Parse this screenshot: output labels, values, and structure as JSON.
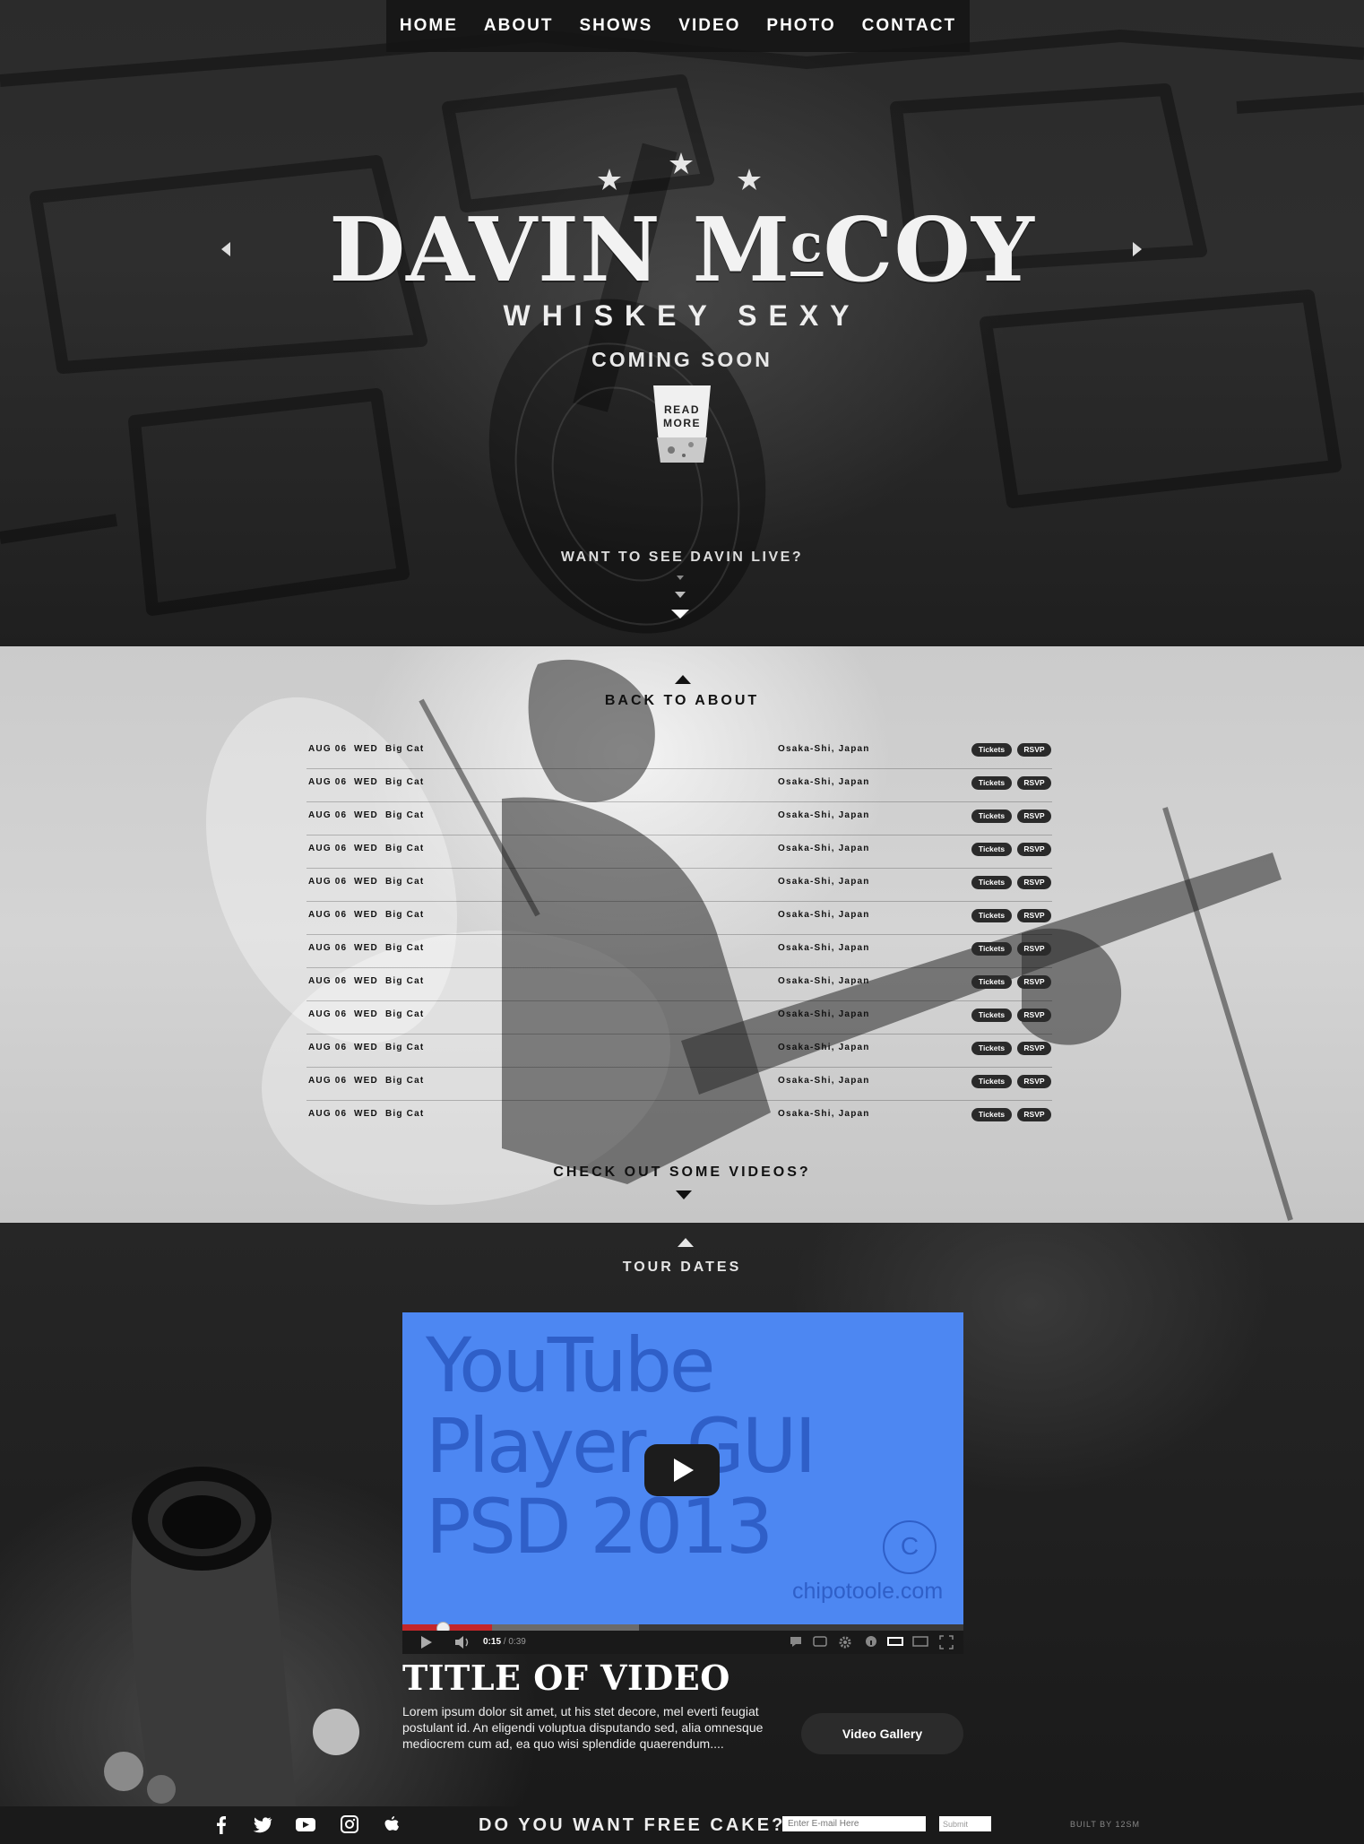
{
  "nav": {
    "items": [
      {
        "label": "HOME"
      },
      {
        "label": "ABOUT"
      },
      {
        "label": "SHOWS"
      },
      {
        "label": "VIDEO"
      },
      {
        "label": "PHOTO"
      },
      {
        "label": "CONTACT"
      }
    ]
  },
  "hero": {
    "title_main": "DAVIN M",
    "title_small": "c",
    "title_end": "COY",
    "subtitle": "WHISKEY SEXY",
    "coming": "COMING SOON",
    "read_more": {
      "line1": "READ",
      "line2": "MORE"
    },
    "live_cta": "WANT TO SEE DAVIN LIVE?"
  },
  "tour": {
    "back_label": "BACK TO ABOUT",
    "next_label": "CHECK OUT SOME VIDEOS?",
    "shows": [
      {
        "date": "AUG 06",
        "day": "WED",
        "venue": "Big Cat",
        "city": "Osaka-Shi, Japan",
        "tickets": "Tickets",
        "rsvp": "RSVP"
      },
      {
        "date": "AUG 06",
        "day": "WED",
        "venue": "Big Cat",
        "city": "Osaka-Shi, Japan",
        "tickets": "Tickets",
        "rsvp": "RSVP"
      },
      {
        "date": "AUG 06",
        "day": "WED",
        "venue": "Big Cat",
        "city": "Osaka-Shi, Japan",
        "tickets": "Tickets",
        "rsvp": "RSVP"
      },
      {
        "date": "AUG 06",
        "day": "WED",
        "venue": "Big Cat",
        "city": "Osaka-Shi, Japan",
        "tickets": "Tickets",
        "rsvp": "RSVP"
      },
      {
        "date": "AUG 06",
        "day": "WED",
        "venue": "Big Cat",
        "city": "Osaka-Shi, Japan",
        "tickets": "Tickets",
        "rsvp": "RSVP"
      },
      {
        "date": "AUG 06",
        "day": "WED",
        "venue": "Big Cat",
        "city": "Osaka-Shi, Japan",
        "tickets": "Tickets",
        "rsvp": "RSVP"
      },
      {
        "date": "AUG 06",
        "day": "WED",
        "venue": "Big Cat",
        "city": "Osaka-Shi, Japan",
        "tickets": "Tickets",
        "rsvp": "RSVP"
      },
      {
        "date": "AUG 06",
        "day": "WED",
        "venue": "Big Cat",
        "city": "Osaka-Shi, Japan",
        "tickets": "Tickets",
        "rsvp": "RSVP"
      },
      {
        "date": "AUG 06",
        "day": "WED",
        "venue": "Big Cat",
        "city": "Osaka-Shi, Japan",
        "tickets": "Tickets",
        "rsvp": "RSVP"
      },
      {
        "date": "AUG 06",
        "day": "WED",
        "venue": "Big Cat",
        "city": "Osaka-Shi, Japan",
        "tickets": "Tickets",
        "rsvp": "RSVP"
      },
      {
        "date": "AUG 06",
        "day": "WED",
        "venue": "Big Cat",
        "city": "Osaka-Shi, Japan",
        "tickets": "Tickets",
        "rsvp": "RSVP"
      },
      {
        "date": "AUG 06",
        "day": "WED",
        "venue": "Big Cat",
        "city": "Osaka-Shi, Japan",
        "tickets": "Tickets",
        "rsvp": "RSVP"
      }
    ]
  },
  "video": {
    "back_label": "TOUR DATES",
    "thumb_text": [
      "YouTube",
      "Player  GUI",
      "PSD 2013"
    ],
    "thumb_credit": "chipotoole.com",
    "thumb_circle": "C",
    "time_current": "0:15",
    "time_total": "/ 0:39",
    "progress_played": 0.38,
    "title": "TITLE OF VIDEO",
    "description": "Lorem ipsum dolor sit amet, ut his stet decore, mel everti feugiat postulant id. An eligendi voluptua disputando sed, alia omnesque mediocrem cum ad, ea quo wisi splendide quaerendum....",
    "gallery_button": "Video Gallery"
  },
  "footer": {
    "social_icons": [
      "facebook-icon",
      "twitter-icon",
      "youtube-icon",
      "instagram-icon",
      "apple-icon"
    ],
    "cake_text": "DO YOU WANT FREE CAKE?",
    "email_placeholder": "Enter E-mail Here",
    "submit_label": "Submit",
    "built_by": "BUILT BY 12SM"
  },
  "colors": {
    "accent_red": "#c4262a",
    "player_blue": "#4d87f2",
    "pill_dark": "#2a2a2a"
  }
}
